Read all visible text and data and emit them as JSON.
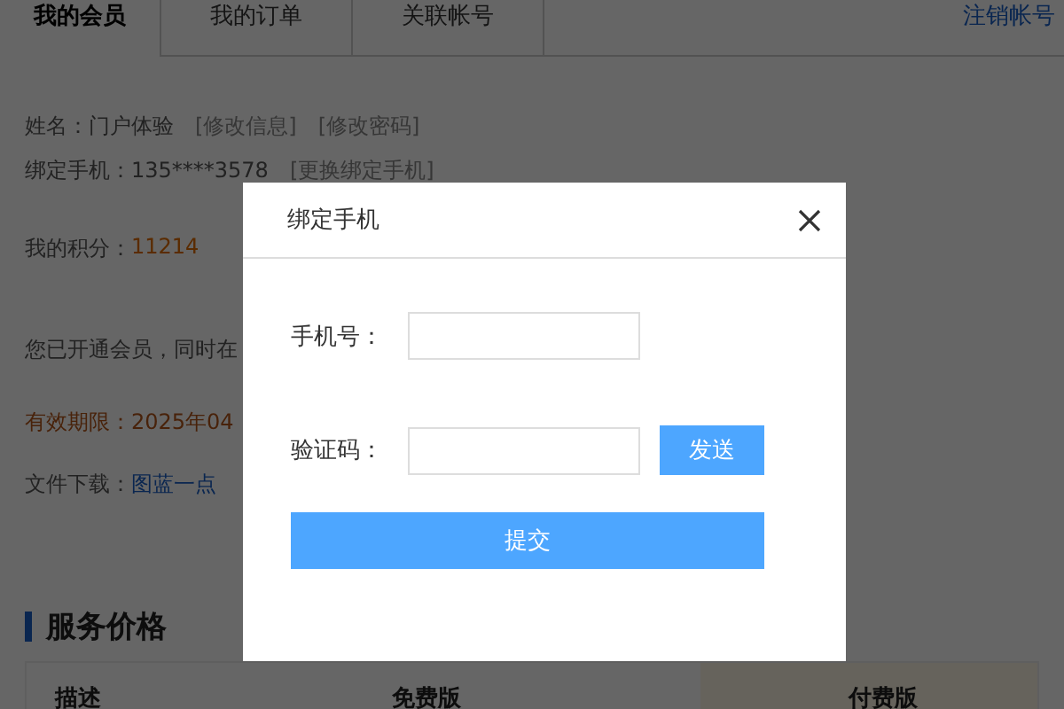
{
  "tabs": [
    {
      "label": "我的会员",
      "selected": true
    },
    {
      "label": "我的订单",
      "selected": false
    },
    {
      "label": "关联帐号",
      "selected": false
    }
  ],
  "logout_link": "注销帐号",
  "profile": {
    "name_label": "姓名：门户体验",
    "edit_info": "[修改信息]",
    "edit_password": "[修改密码]",
    "phone_label": "绑定手机：135****3578",
    "change_phone": "[更换绑定手机]",
    "points_label": "我的积分：",
    "points": "11214",
    "member_note": "您已开通会员，同时在",
    "expiry": "有效期限：2025年04",
    "download_label": "文件下载：",
    "download_link": "图蓝一点"
  },
  "pricing": {
    "title": "服务价格",
    "columns": [
      "描述",
      "免费版",
      "付费版"
    ]
  },
  "dialog": {
    "title": "绑定手机",
    "phone_label": "手机号：",
    "code_label": "验证码：",
    "send_button": "发送",
    "submit_button": "提交"
  }
}
